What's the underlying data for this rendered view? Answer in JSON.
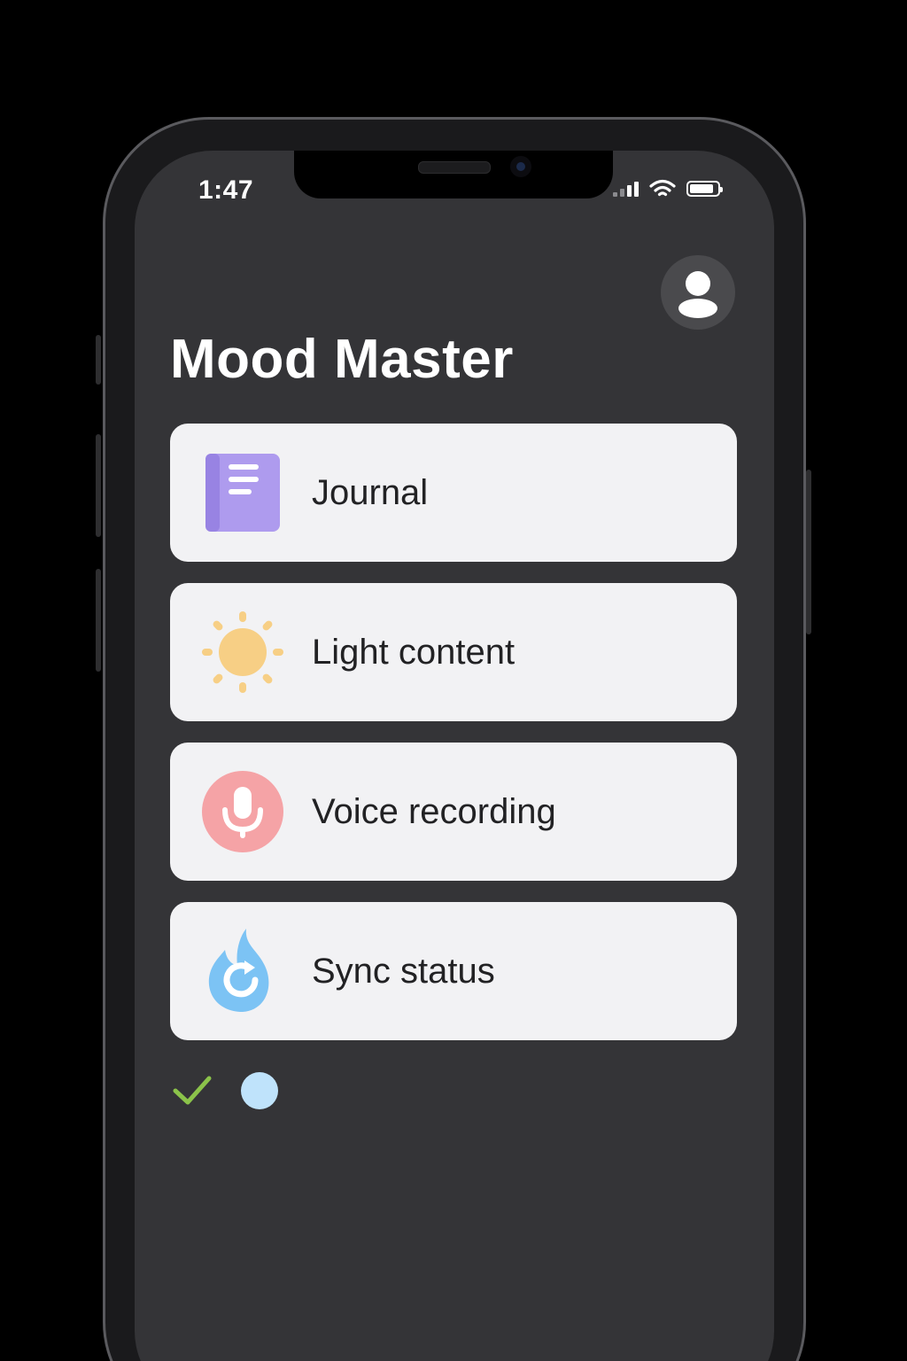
{
  "status_bar": {
    "time": "1:47",
    "signal_bars_active": 2,
    "battery_level": 0.85
  },
  "header": {
    "title": "Mood Master",
    "avatar_icon": "user-icon"
  },
  "menu": {
    "items": [
      {
        "label": "Journal",
        "icon": "journal-book-icon",
        "color": "#a896ec"
      },
      {
        "label": "Light content",
        "icon": "sun-icon",
        "color": "#f7cf85"
      },
      {
        "label": "Voice recording",
        "icon": "microphone-icon",
        "color": "#f5a3a6"
      },
      {
        "label": "Sync status",
        "icon": "sync-flame-icon",
        "color": "#7cc3f4"
      }
    ]
  },
  "footer": {
    "check_icon": "check-icon",
    "check_color": "#8bc34a",
    "dot_color": "#bfe3fb"
  },
  "colors": {
    "screen_background": "#343437",
    "card_background": "#f2f2f4",
    "text_primary": "#ffffff",
    "card_text": "#222224"
  }
}
